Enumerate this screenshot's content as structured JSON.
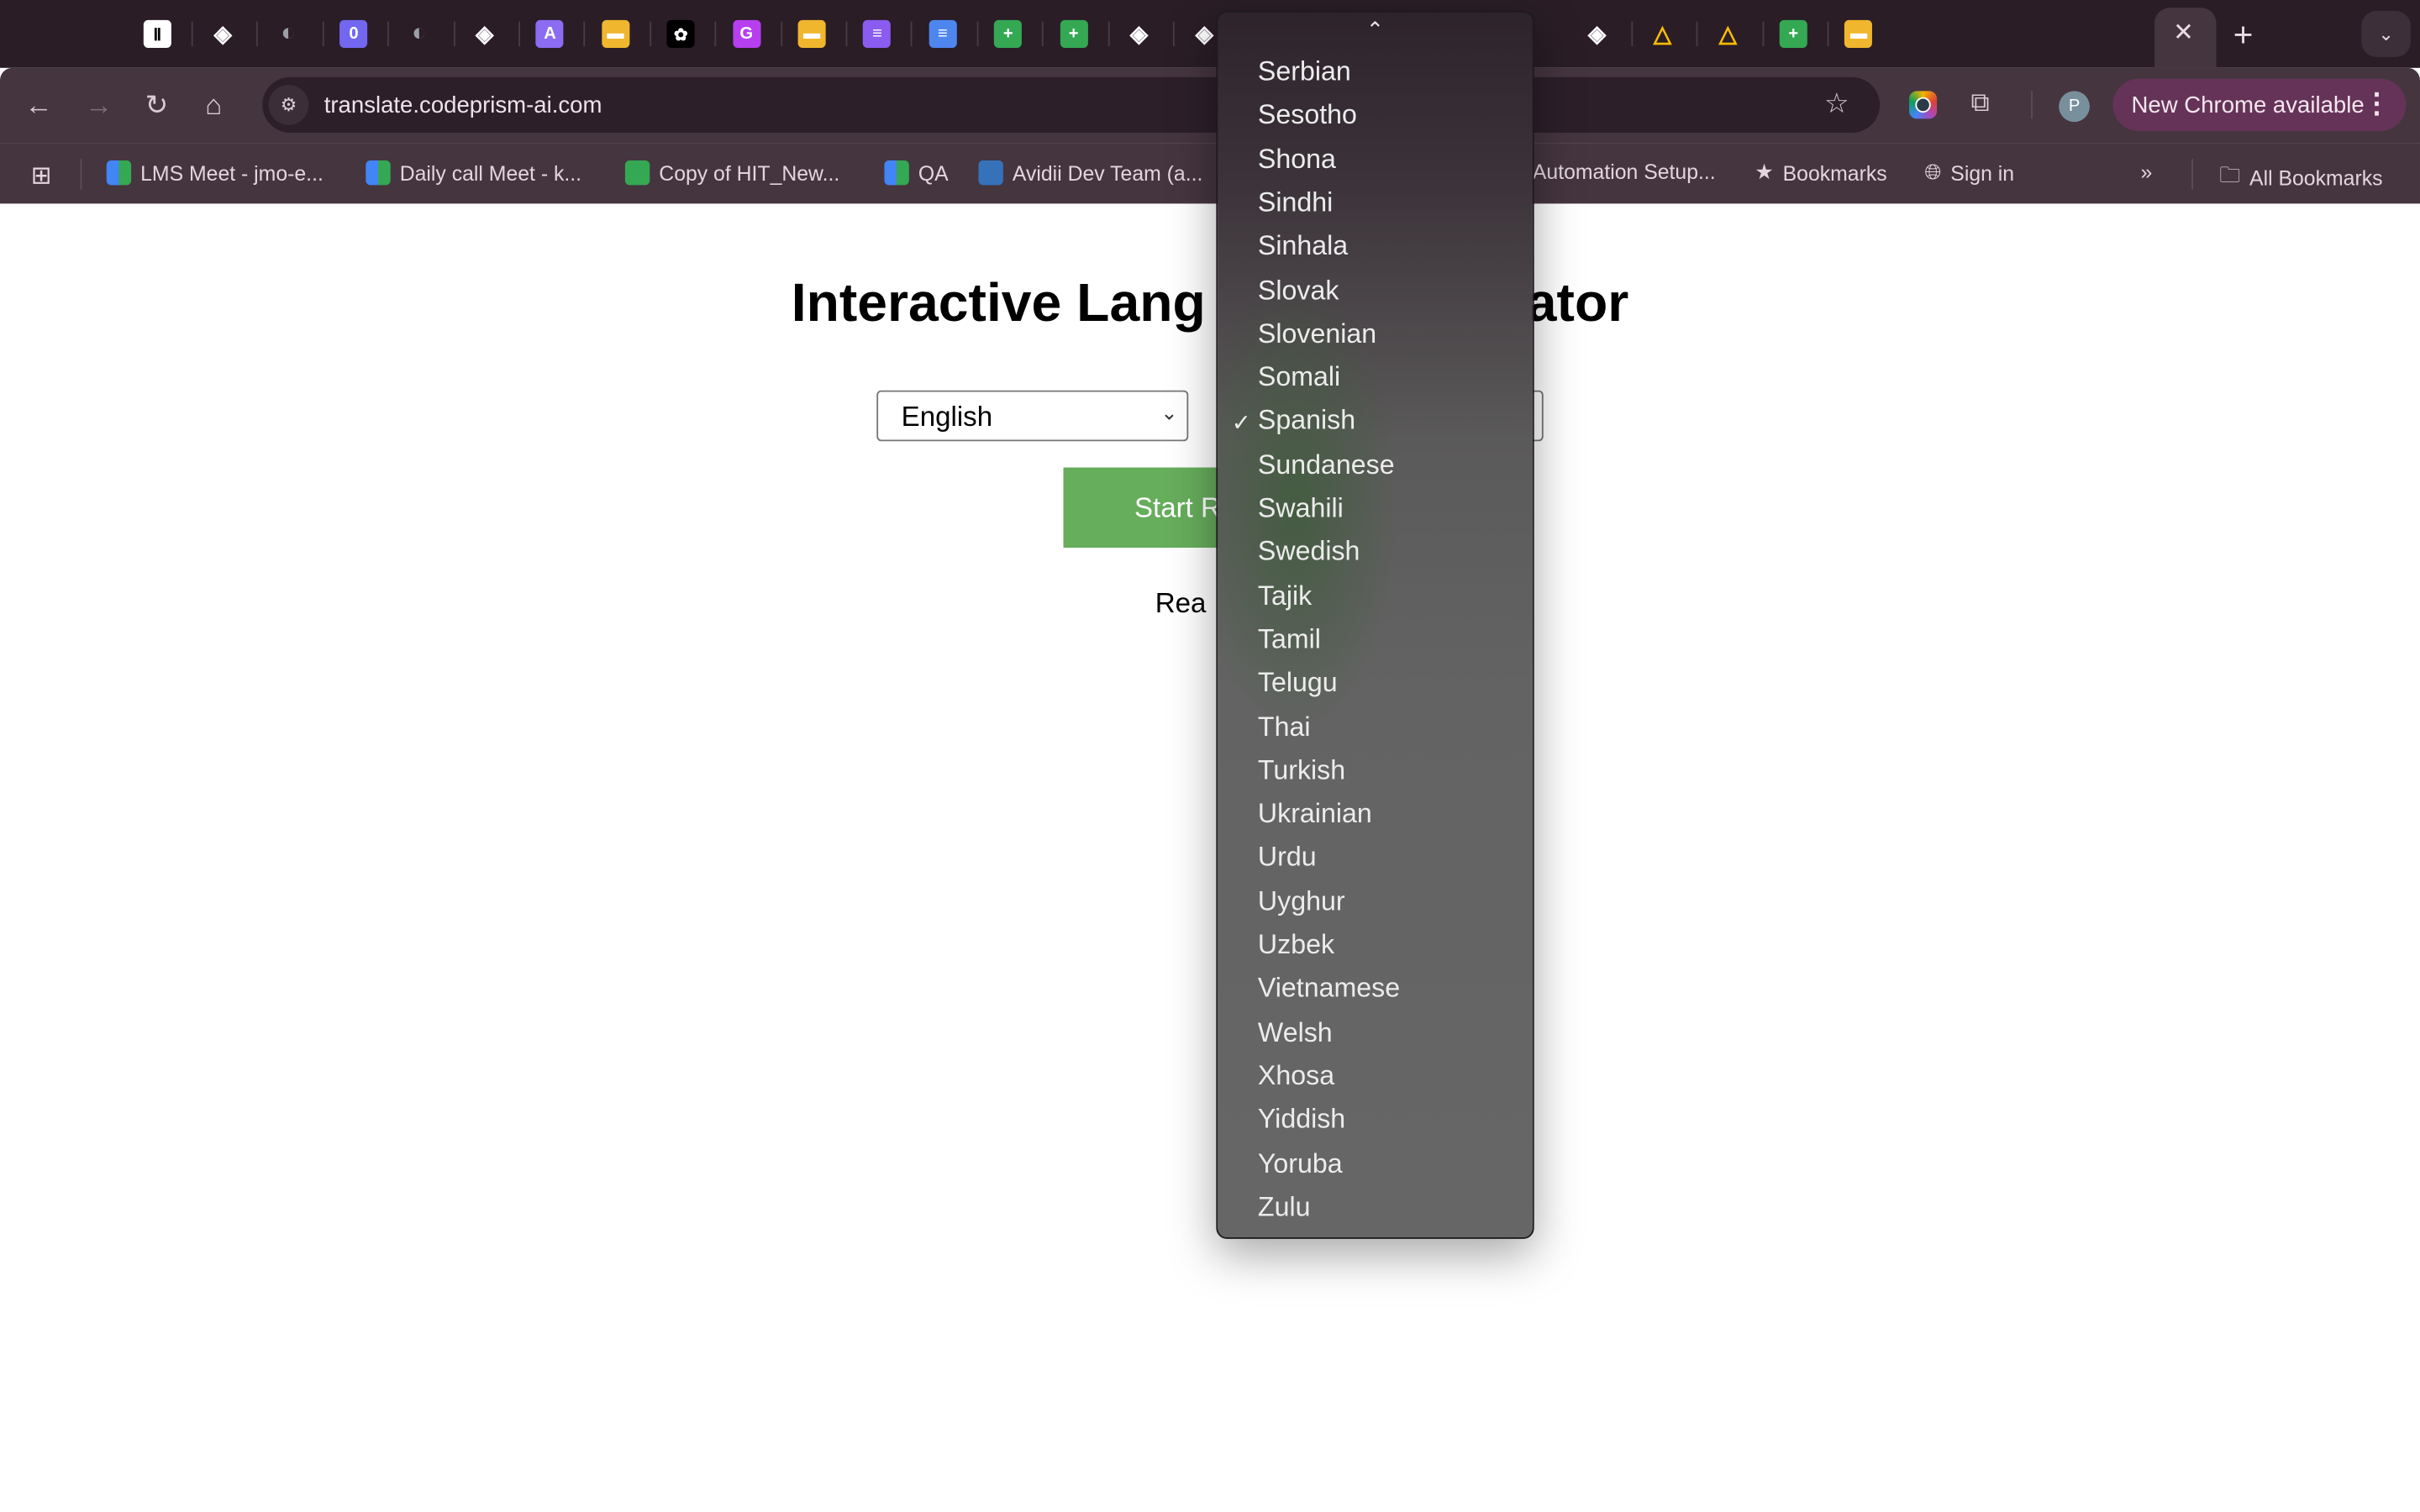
{
  "browser": {
    "tabs": [
      {
        "icon": "pause-icon",
        "color": "#ffffff"
      },
      {
        "icon": "diamond-icon",
        "color": "#2a1d26"
      },
      {
        "icon": "globe-icon",
        "color": "#9aa0a6"
      },
      {
        "icon": "calendar-app-icon",
        "color": "#7367f0"
      },
      {
        "icon": "globe-icon",
        "color": "#9aa0a6"
      },
      {
        "icon": "diamond-icon",
        "color": "#2a1d26"
      },
      {
        "icon": "arc-app-icon",
        "color": "#8b6cf2"
      },
      {
        "icon": "slides-icon",
        "color": "#f0b62d"
      },
      {
        "icon": "openai-icon",
        "color": "#000000"
      },
      {
        "icon": "hexagon-app-icon",
        "color": "#b63ff0"
      },
      {
        "icon": "slides-icon",
        "color": "#f0b62d"
      },
      {
        "icon": "stripes-app-icon",
        "color": "#8a5cf0"
      },
      {
        "icon": "docs-icon",
        "color": "#4e86f0"
      },
      {
        "icon": "sheets-icon",
        "color": "#34a853"
      },
      {
        "icon": "sheets-icon",
        "color": "#34a853"
      },
      {
        "icon": "diamond-icon",
        "color": "#2a1d26"
      },
      {
        "icon": "diamond-icon",
        "color": "#2a1d26"
      },
      {
        "icon": "docs-icon",
        "color": "#4e86f0"
      },
      {
        "icon": "meet-icon",
        "color": "#00897b"
      },
      {
        "icon": "bracket-app-icon",
        "color": "#000000"
      },
      {
        "icon": "forms-app-icon",
        "color": "#3d6ef0"
      },
      {
        "icon": "globe-icon",
        "color": "#9aa0a6"
      },
      {
        "icon": "diamond-icon",
        "color": "#2a1d26"
      },
      {
        "icon": "drive-icon",
        "color": "#2a1d26"
      },
      {
        "icon": "drive-icon",
        "color": "#2a1d26"
      },
      {
        "icon": "sheets-icon",
        "color": "#34a853"
      },
      {
        "icon": "slides-icon",
        "color": "#f0b62d"
      }
    ],
    "active_tab_close": "✕",
    "new_tab": "+",
    "tab_search": "⌄",
    "url": "translate.codeprism-ai.com",
    "update_button": "New Chrome available",
    "avatar_letter": "P",
    "bookmarks": [
      {
        "label": "LMS Meet - jmo-e...",
        "icon": "meet-icon"
      },
      {
        "label": "Daily call Meet - k...",
        "icon": "meet-icon"
      },
      {
        "label": "Copy of HIT_New...",
        "icon": "sheets-icon"
      },
      {
        "label": "QA",
        "icon": "meet-icon"
      },
      {
        "label": "Avidii Dev Team (a...",
        "icon": "pivotal-icon"
      },
      {
        "label": "Automation Setup...",
        "icon": ""
      },
      {
        "label": "Bookmarks",
        "icon": "star-icon"
      },
      {
        "label": "Sign in",
        "icon": "globe-icon"
      }
    ],
    "more_bookmarks": "»",
    "all_bookmarks": "All Bookmarks"
  },
  "page": {
    "title": "Interactive Lang",
    "title_tail": "ator",
    "source_language": "English",
    "start_button": "Start Re",
    "status": "Rea"
  },
  "dropdown": {
    "scroll_up": "⌃",
    "selected": "Spanish",
    "check": "✓",
    "options": [
      "Serbian",
      "Sesotho",
      "Shona",
      "Sindhi",
      "Sinhala",
      "Slovak",
      "Slovenian",
      "Somali",
      "Spanish",
      "Sundanese",
      "Swahili",
      "Swedish",
      "Tajik",
      "Tamil",
      "Telugu",
      "Thai",
      "Turkish",
      "Ukrainian",
      "Urdu",
      "Uyghur",
      "Uzbek",
      "Vietnamese",
      "Welsh",
      "Xhosa",
      "Yiddish",
      "Yoruba",
      "Zulu"
    ]
  }
}
